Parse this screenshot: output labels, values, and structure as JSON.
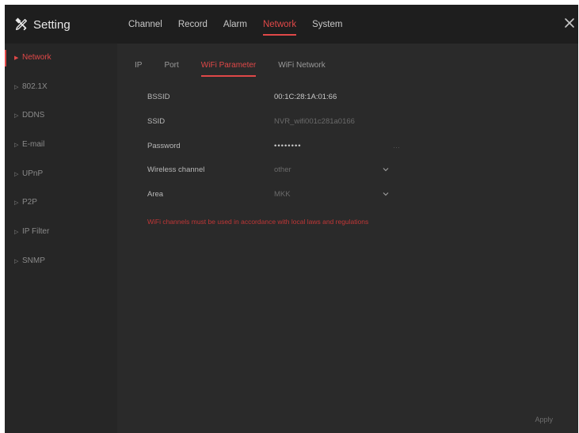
{
  "app": {
    "title": "Setting"
  },
  "main_nav": [
    {
      "label": "Channel",
      "active": false
    },
    {
      "label": "Record",
      "active": false
    },
    {
      "label": "Alarm",
      "active": false
    },
    {
      "label": "Network",
      "active": true
    },
    {
      "label": "System",
      "active": false
    }
  ],
  "sidebar": {
    "items": [
      {
        "label": "Network",
        "active": true
      },
      {
        "label": "802.1X",
        "active": false
      },
      {
        "label": "DDNS",
        "active": false
      },
      {
        "label": "E-mail",
        "active": false
      },
      {
        "label": "UPnP",
        "active": false
      },
      {
        "label": "P2P",
        "active": false
      },
      {
        "label": "IP Filter",
        "active": false
      },
      {
        "label": "SNMP",
        "active": false
      }
    ]
  },
  "sub_tabs": [
    {
      "label": "IP",
      "active": false
    },
    {
      "label": "Port",
      "active": false
    },
    {
      "label": "WiFi Parameter",
      "active": true
    },
    {
      "label": "WiFi Network",
      "active": false
    }
  ],
  "wifi": {
    "bssid_label": "BSSID",
    "bssid_value": "00:1C:28:1A:01:66",
    "ssid_label": "SSID",
    "ssid_value": "NVR_wifi001c281a0166",
    "password_label": "Password",
    "password_value": "••••••••",
    "channel_label": "Wireless channel",
    "channel_value": "other",
    "area_label": "Area",
    "area_value": "MKK",
    "notice": "WiFi channels must be used in accordance with local laws and regulations"
  },
  "footer": {
    "apply_label": "Apply"
  },
  "colors": {
    "accent": "#e04848",
    "background": "#2a2a2a",
    "topbar": "#1e1e1e"
  }
}
